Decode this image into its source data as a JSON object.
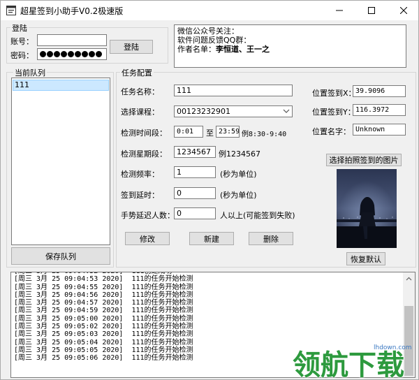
{
  "window": {
    "title": "超星签到小助手V0.2极速版"
  },
  "login": {
    "group_title": "登陆",
    "account_label": "账号：",
    "account_value": "",
    "password_label": "密码：",
    "password_dots": 9,
    "login_button": "登陆"
  },
  "info": {
    "line1": "微信公众号关注：",
    "line2": "软件问题反馈QQ群：",
    "line3_prefix": "作者名单：",
    "line3_names": "李恒道、王一之"
  },
  "queue": {
    "group_title": "当前队列",
    "items": [
      "111"
    ],
    "save_button": "保存队列"
  },
  "task": {
    "group_title": "任务配置",
    "name_label": "任务名称：",
    "name_value": "111",
    "course_label": "选择课程：",
    "course_value": "00123232901",
    "time_label": "检测时间段：",
    "time_start": "0:01",
    "time_sep": "至",
    "time_end": "23:59",
    "time_example": "例8:30-9:40",
    "weekday_label": "检测星期段：",
    "weekday_value": "1234567",
    "weekday_example": "例1234567",
    "freq_label": "检测频率：",
    "freq_value": "1",
    "freq_unit": "(秒为单位)",
    "delay_label": "签到延时：",
    "delay_value": "0",
    "delay_unit": "(秒为单位)",
    "gesture_label": "手势延迟人数：",
    "gesture_value": "0",
    "gesture_note": "人以上(可能签到失败)",
    "modify_button": "修改",
    "new_button": "新建",
    "delete_button": "删除"
  },
  "location": {
    "x_label": "位置签到X：",
    "x_value": "39.9096",
    "y_label": "位置签到Y：",
    "y_value": "116.3972",
    "name_label": "位置名字：",
    "name_value": "Unknown",
    "select_photo_button": "选择拍照签到的图片",
    "restore_button": "恢复默认"
  },
  "log": {
    "lines": [
      "[周三 3月 25 09:04:52 2020]  111创建成功",
      "[周三 3月 25 09:04:53 2020]  111的任务开始检测",
      "[周三 3月 25 09:04:55 2020]  111的任务开始检测",
      "[周三 3月 25 09:04:56 2020]  111的任务开始检测",
      "[周三 3月 25 09:04:57 2020]  111的任务开始检测",
      "[周三 3月 25 09:04:59 2020]  111的任务开始检测",
      "[周三 3月 25 09:05:00 2020]  111的任务开始检测",
      "[周三 3月 25 09:05:02 2020]  111的任务开始检测",
      "[周三 3月 25 09:05:03 2020]  111的任务开始检测",
      "[周三 3月 25 09:05:04 2020]  111的任务开始检测",
      "[周三 3月 25 09:05:05 2020]  111的任务开始检测",
      "[周三 3月 25 09:05:06 2020]  111的任务开始检测"
    ]
  },
  "watermark": {
    "site": "lhdown.com",
    "text": "领航下载"
  },
  "colors": {
    "selection": "#cce8ff",
    "focus": "#0078d7",
    "watermark_green": "#2d9a3e"
  }
}
